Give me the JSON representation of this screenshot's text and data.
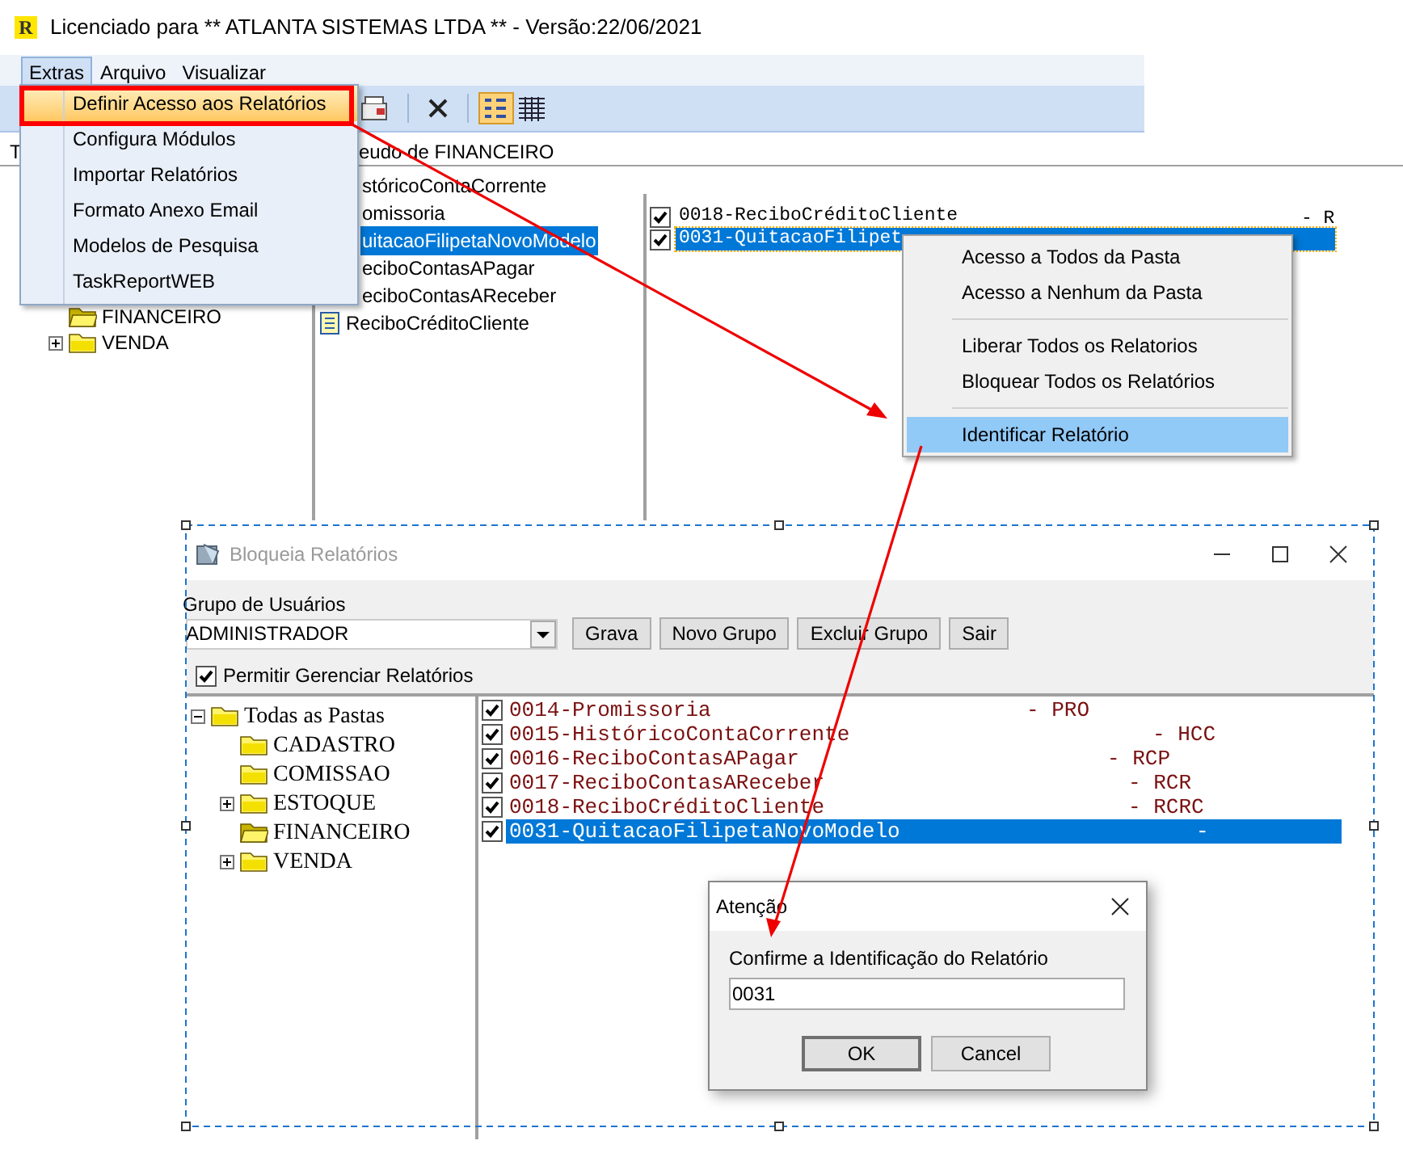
{
  "main_window": {
    "logo": "R",
    "title": "Licenciado para ** ATLANTA SISTEMAS LTDA ** - Versão:22/06/2021",
    "menu": [
      {
        "label": "Extras",
        "selected": true
      },
      {
        "label": "Arquivo",
        "selected": false
      },
      {
        "label": "Visualizar",
        "selected": false
      }
    ],
    "column_header": "T",
    "folder_header": "eudo de FINANCEIRO",
    "tree": [
      {
        "label": "FINANCEIRO",
        "expandable": false,
        "open": true
      },
      {
        "label": "VENDA",
        "expandable": true,
        "open": false
      }
    ],
    "folder_items": [
      {
        "label": "stóricoContaCorrente",
        "kind": "clipped",
        "selected": false
      },
      {
        "label": "omissoria",
        "kind": "clipped",
        "selected": false
      },
      {
        "label": "uitacaoFilipetaNovoModelo",
        "kind": "clipped",
        "selected": true
      },
      {
        "label": "eciboContasAPagar",
        "kind": "clipped",
        "selected": false
      },
      {
        "label": "eciboContasAReceber",
        "kind": "clipped",
        "selected": false
      },
      {
        "label": "ReciboCréditoCliente",
        "kind": "full",
        "selected": false
      }
    ],
    "reports": [
      {
        "label": "0018-ReciboCréditoCliente",
        "code": "- R",
        "checked": true,
        "selected": false
      },
      {
        "label": "0031-QuitacaoFilipet",
        "checked": true,
        "selected": true
      }
    ]
  },
  "extras_menu": {
    "items": [
      {
        "label": "Definir Acesso aos Relatórios",
        "selected": true
      },
      {
        "label": "Configura Módulos",
        "selected": false
      },
      {
        "label": "Importar Relatórios",
        "selected": false
      },
      {
        "label": "Formato Anexo Email",
        "selected": false
      },
      {
        "label": "Modelos de Pesquisa",
        "selected": false
      },
      {
        "label": "TaskReportWEB",
        "selected": false
      }
    ]
  },
  "context_menu": {
    "groups": [
      [
        {
          "label": "Acesso a Todos da Pasta",
          "selected": false
        },
        {
          "label": "Acesso a Nenhum da Pasta",
          "selected": false
        }
      ],
      [
        {
          "label": "Liberar Todos os Relatorios",
          "selected": false
        },
        {
          "label": "Bloquear Todos os Relatórios",
          "selected": false
        }
      ],
      [
        {
          "label": "Identificar Relatório",
          "selected": true
        }
      ]
    ]
  },
  "report_window": {
    "title": "Bloqueia Relatórios",
    "group_label": "Grupo de Usuários",
    "group_value": "ADMINISTRADOR",
    "buttons": [
      "Grava",
      "Novo Grupo",
      "Excluir Grupo",
      "Sair"
    ],
    "permit": {
      "label": "Permitir Gerenciar Relatórios",
      "checked": true
    },
    "tree": {
      "label": "Todas as Pastas",
      "expanded": true,
      "children": [
        {
          "label": "CADASTRO",
          "expandable": false,
          "open": false
        },
        {
          "label": "COMISSAO",
          "expandable": false,
          "open": false
        },
        {
          "label": "ESTOQUE",
          "expandable": true,
          "open": false
        },
        {
          "label": "FINANCEIRO",
          "expandable": false,
          "open": true
        },
        {
          "label": "VENDA",
          "expandable": true,
          "open": false
        }
      ]
    },
    "reports": [
      {
        "label": "0014-Promissoria",
        "code": "- PRO",
        "checked": true,
        "selected": false
      },
      {
        "label": "0015-HistóricoContaCorrente",
        "code": "- HCC",
        "checked": true,
        "selected": false
      },
      {
        "label": "0016-ReciboContasAPagar",
        "code": "- RCP",
        "checked": true,
        "selected": false
      },
      {
        "label": "0017-ReciboContasAReceber",
        "code": "- RCR",
        "checked": true,
        "selected": false
      },
      {
        "label": "0018-ReciboCréditoCliente",
        "code": "- RCRC",
        "checked": true,
        "selected": false
      },
      {
        "label": "0031-QuitacaoFilipetaNovoModelo",
        "code": "-",
        "checked": true,
        "selected": true
      }
    ]
  },
  "dialog": {
    "title": "Atenção",
    "prompt": "Confirme a Identificação do Relatório",
    "value": "0031",
    "buttons": [
      "OK",
      "Cancel"
    ]
  }
}
